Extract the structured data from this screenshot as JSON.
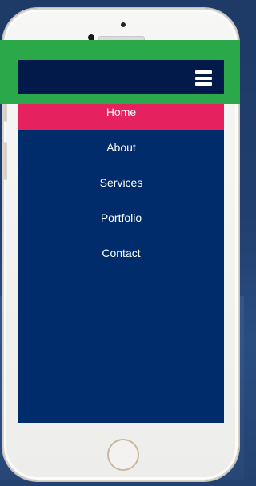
{
  "colors": {
    "header_bg": "#011a49",
    "menu_bg": "#002c6b",
    "active_item_bg": "#e5215f",
    "highlight": "#2aa84a",
    "text": "#ffffff"
  },
  "header": {
    "menu_icon": "hamburger-icon"
  },
  "menu": {
    "items": [
      {
        "label": "Home",
        "active": true
      },
      {
        "label": "About",
        "active": false
      },
      {
        "label": "Services",
        "active": false
      },
      {
        "label": "Portfolio",
        "active": false
      },
      {
        "label": "Contact",
        "active": false
      }
    ]
  }
}
